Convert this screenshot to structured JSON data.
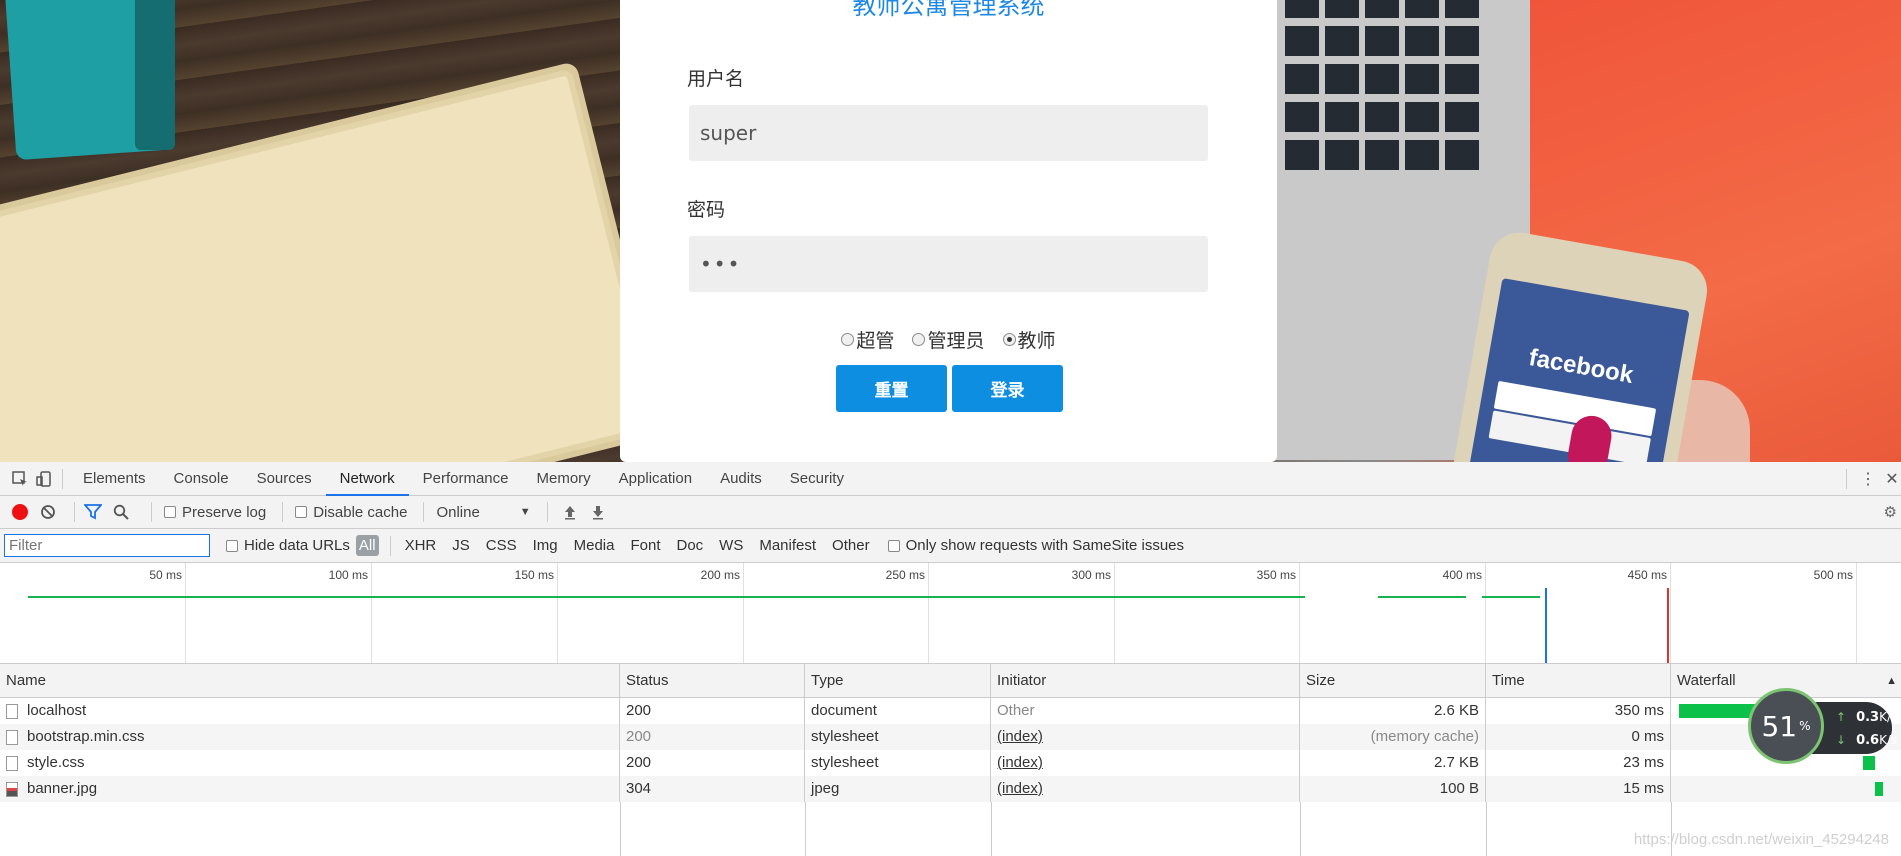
{
  "login": {
    "title": "教师公寓管理系统",
    "username_label": "用户名",
    "username_value": "super",
    "password_label": "密码",
    "password_value": "•••",
    "roles": [
      {
        "label": "超管",
        "checked": false
      },
      {
        "label": "管理员",
        "checked": false
      },
      {
        "label": "教师",
        "checked": true
      }
    ],
    "reset_label": "重置",
    "login_label": "登录"
  },
  "banner": {
    "phone_brand_text": "facebook"
  },
  "devtools": {
    "tabs": [
      "Elements",
      "Console",
      "Sources",
      "Network",
      "Performance",
      "Memory",
      "Application",
      "Audits",
      "Security"
    ],
    "active_tab": "Network",
    "toolbar": {
      "preserve_log": "Preserve log",
      "disable_cache": "Disable cache",
      "throttling": "Online"
    },
    "filterbar": {
      "filter_placeholder": "Filter",
      "hide_data_urls": "Hide data URLs",
      "types": [
        "All",
        "XHR",
        "JS",
        "CSS",
        "Img",
        "Media",
        "Font",
        "Doc",
        "WS",
        "Manifest",
        "Other"
      ],
      "active_type": "All",
      "samesite": "Only show requests with SameSite issues"
    },
    "overview_ticks": [
      "50 ms",
      "100 ms",
      "150 ms",
      "200 ms",
      "250 ms",
      "300 ms",
      "350 ms",
      "400 ms",
      "450 ms",
      "500 ms"
    ],
    "columns": [
      "Name",
      "Status",
      "Type",
      "Initiator",
      "Size",
      "Time",
      "Waterfall"
    ],
    "rows": [
      {
        "name": "localhost",
        "status": "200",
        "type": "document",
        "initiator": "Other",
        "size": "2.6 KB",
        "time": "350 ms",
        "icon": "file-icon"
      },
      {
        "name": "bootstrap.min.css",
        "status": "200",
        "type": "stylesheet",
        "initiator": "(index)",
        "size": "(memory cache)",
        "time": "0 ms",
        "icon": "file-icon"
      },
      {
        "name": "style.css",
        "status": "200",
        "type": "stylesheet",
        "initiator": "(index)",
        "size": "2.7 KB",
        "time": "23 ms",
        "icon": "file-icon"
      },
      {
        "name": "banner.jpg",
        "status": "304",
        "type": "jpeg",
        "initiator": "(index)",
        "size": "100 B",
        "time": "15 ms",
        "icon": "image-icon"
      }
    ]
  },
  "net_widget": {
    "percent": "51",
    "percent_unit": "%",
    "upload": "0.3",
    "download": "0.6",
    "unit": "K/s"
  },
  "watermark": "https://blog.csdn.net/weixin_45294248",
  "colors": {
    "accent": "#0e8ee0",
    "title": "#1e88e5",
    "waterfall": "#0bc14a",
    "devtools_active": "#1a73e8"
  }
}
